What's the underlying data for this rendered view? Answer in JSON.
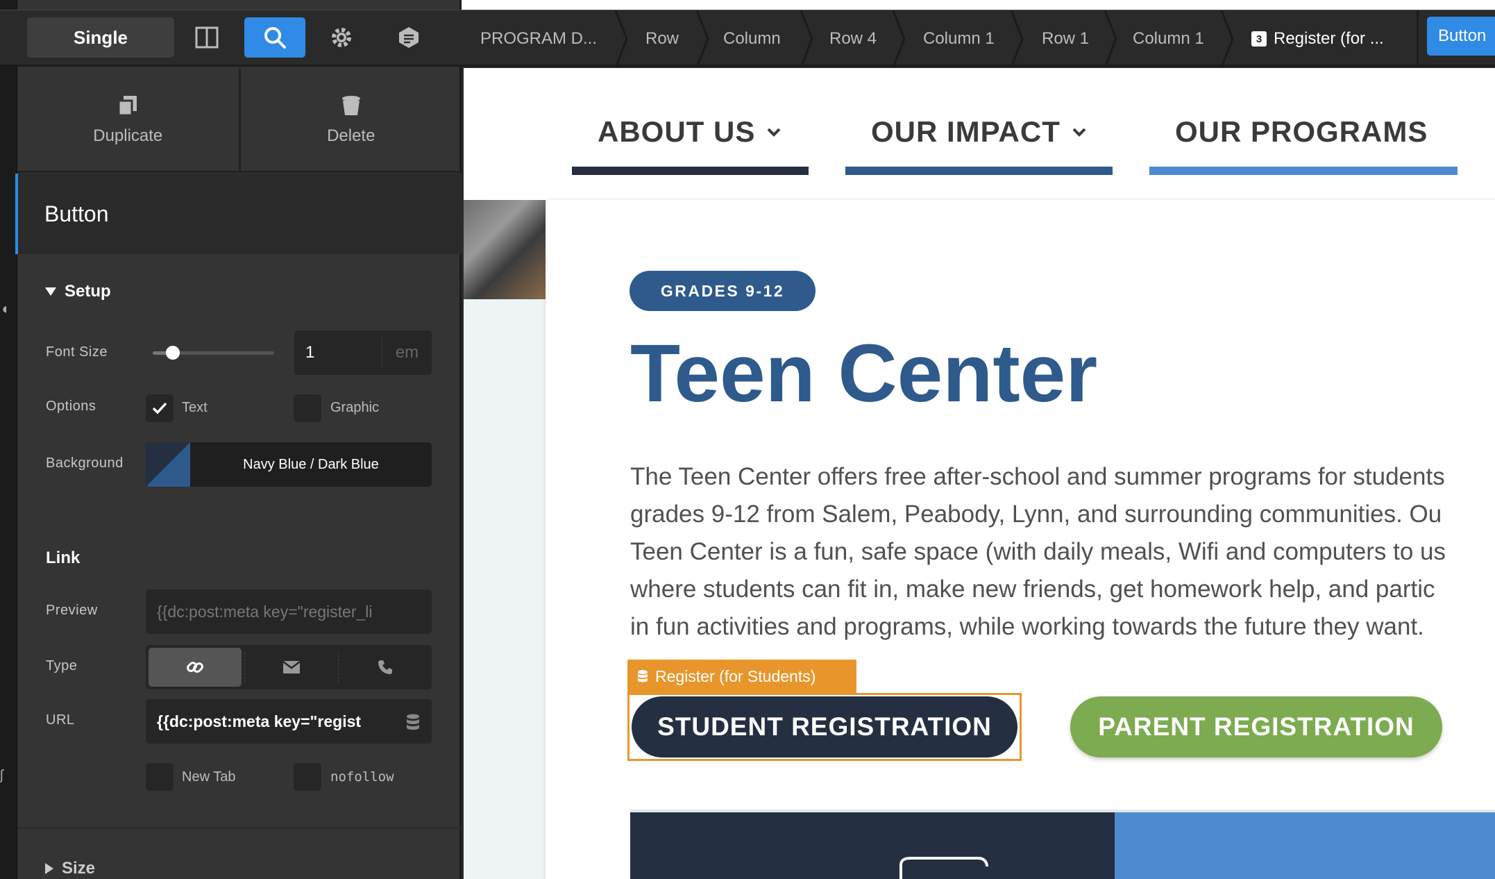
{
  "toolbar": {
    "single_label": "Single",
    "icons": [
      "layout-columns-icon",
      "search-icon",
      "gear-icon",
      "layers-icon"
    ]
  },
  "actions": {
    "duplicate_label": "Duplicate",
    "delete_label": "Delete"
  },
  "element": {
    "title": "Button"
  },
  "setup": {
    "heading": "Setup",
    "font_size_label": "Font Size",
    "font_size_value": "1",
    "font_size_unit": "em",
    "font_size_slider_fraction": 0.12,
    "options_label": "Options",
    "option_text_label": "Text",
    "option_text_checked": true,
    "option_graphic_label": "Graphic",
    "option_graphic_checked": false,
    "background_label": "Background",
    "background_value": "Navy Blue / Dark Blue",
    "background_colors": [
      "#242f42",
      "#2e5a8c"
    ]
  },
  "link": {
    "heading": "Link",
    "preview_label": "Preview",
    "preview_value": "{{dc:post:meta key=\"register_li",
    "type_label": "Type",
    "type_options": [
      "link-icon",
      "envelope-icon",
      "phone-icon"
    ],
    "url_label": "URL",
    "url_value": "{{dc:post:meta key=\"regist",
    "new_tab_label": "New Tab",
    "nofollow_label": "nofollow"
  },
  "size": {
    "heading": "Size"
  },
  "breadcrumbs": {
    "items": [
      "PROGRAM D...",
      "Row",
      "Column",
      "Row 4",
      "Column 1",
      "Row 1",
      "Column 1"
    ],
    "current_badge": "3",
    "current_label": "Register (for ...",
    "end_button": "Button"
  },
  "site": {
    "nav": [
      {
        "label": "ABOUT US",
        "has_dropdown": true,
        "bar_color": "#242f42"
      },
      {
        "label": "OUR IMPACT",
        "has_dropdown": true,
        "bar_color": "#2e5a8c"
      },
      {
        "label": "OUR PROGRAMS",
        "has_dropdown": false,
        "bar_color": "#4e8ad0"
      }
    ],
    "grade_pill": "GRADES 9-12",
    "title": "Teen Center",
    "paragraph_lines": [
      "The Teen Center offers free after-school and summer programs for students",
      "grades 9-12 from Salem, Peabody, Lynn, and surrounding communities. Ou",
      "Teen Center is a fun, safe space (with daily meals, Wifi and computers to us",
      "where students can fit in, make new friends, get homework help, and partic",
      "in fun activities and programs, while working towards the future they want."
    ],
    "selection_tag": "Register (for Students)",
    "student_button": "STUDENT REGISTRATION",
    "parent_button": "PARENT REGISTRATION"
  },
  "colors": {
    "accent": "#2f8be6",
    "selection": "#e8962c",
    "navy": "#242f42",
    "brand_blue": "#2e5a8c",
    "green": "#7dab50"
  }
}
